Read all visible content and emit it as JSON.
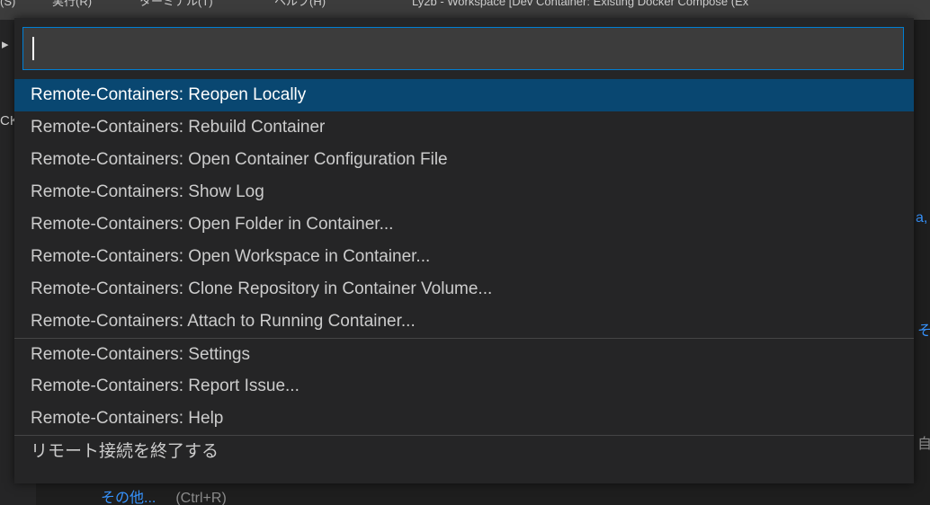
{
  "menubar": {
    "items": [
      "(S)",
      "実行(R)",
      "ターミナル(T)",
      "ヘルプ(H)"
    ],
    "title": "Ly2b - Workspace [Dev Container: Existing Docker Compose (Ex"
  },
  "background": {
    "left_fragments": [
      "▸",
      "CK"
    ],
    "right_fragments": [
      "a,",
      "そ",
      "自"
    ],
    "more_link": "その他...",
    "more_shortcut": "(Ctrl+R)"
  },
  "quick_pick": {
    "input_value": "",
    "items": [
      {
        "label": "Remote-Containers: Reopen Locally",
        "selected": true,
        "separator_before": false
      },
      {
        "label": "Remote-Containers: Rebuild Container",
        "selected": false,
        "separator_before": false
      },
      {
        "label": "Remote-Containers: Open Container Configuration File",
        "selected": false,
        "separator_before": false
      },
      {
        "label": "Remote-Containers: Show Log",
        "selected": false,
        "separator_before": false
      },
      {
        "label": "Remote-Containers: Open Folder in Container...",
        "selected": false,
        "separator_before": false
      },
      {
        "label": "Remote-Containers: Open Workspace in Container...",
        "selected": false,
        "separator_before": false
      },
      {
        "label": "Remote-Containers: Clone Repository in Container Volume...",
        "selected": false,
        "separator_before": false
      },
      {
        "label": "Remote-Containers: Attach to Running Container...",
        "selected": false,
        "separator_before": false
      },
      {
        "label": "Remote-Containers: Settings",
        "selected": false,
        "separator_before": true
      },
      {
        "label": "Remote-Containers: Report Issue...",
        "selected": false,
        "separator_before": false
      },
      {
        "label": "Remote-Containers: Help",
        "selected": false,
        "separator_before": false
      },
      {
        "label": "リモート接続を終了する",
        "selected": false,
        "separator_before": true
      }
    ]
  },
  "colors": {
    "selection": "#094771",
    "focus_border": "#007fd4",
    "link": "#3794ff"
  }
}
